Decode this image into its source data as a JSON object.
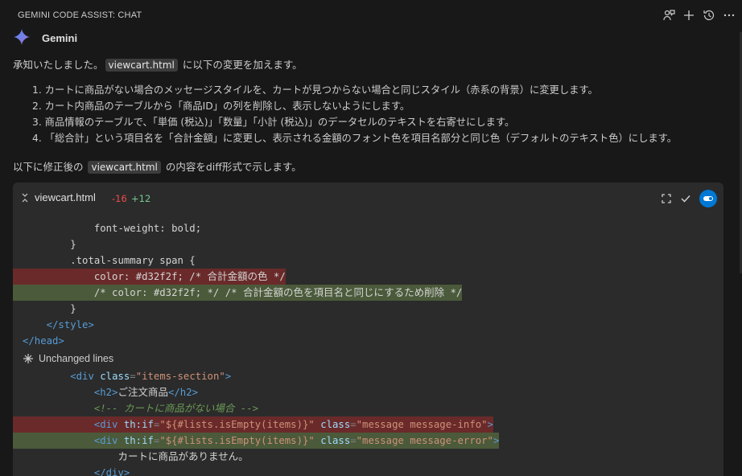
{
  "header": {
    "title": "GEMINI CODE ASSIST: CHAT",
    "icons": [
      "feedback-icon",
      "add-icon",
      "history-icon",
      "more-icon"
    ]
  },
  "assistant": {
    "name": "Gemini"
  },
  "intro": {
    "before": "承知いたしました。",
    "file": "viewcart.html",
    "after": " に以下の変更を加えます。"
  },
  "steps": [
    "1. カートに商品がない場合のメッセージスタイルを、カートが見つからない場合と同じスタイル（赤系の背景）に変更します。",
    "2. カート内商品のテーブルから「商品ID」の列を削除し、表示しないようにします。",
    "3. 商品情報のテーブルで、「単価 (税込)」「数量」「小計 (税込)」のデータセルのテキストを右寄せにします。",
    "4. 「総合計」という項目名を「合計金額」に変更し、表示される金額のフォント色を項目名部分と同じ色（デフォルトのテキスト色）にします。"
  ],
  "diff_intro": {
    "before": "以下に修正後の ",
    "file": "viewcart.html",
    "after": " の内容をdiff形式で示します。"
  },
  "codeblock": {
    "filename": "viewcart.html",
    "deleted": "-16",
    "added": "+12",
    "unchanged_label": "Unchanged lines",
    "accent": "#0078d4",
    "lines": {
      "l1": "font-weight: bold;",
      "l2": "}",
      "l3": ".total-summary span {",
      "l4_a": "color: #d32f2f; /* ",
      "l4_b": "合計金額の色",
      "l4_c": " */",
      "l5_a": "/* color: #d32f2f; */ /* ",
      "l5_b": "合計金額の色を項目名と同じにするため削除",
      "l5_c": " */",
      "l6": "}",
      "l7": "</style>",
      "l8": "</head>",
      "u1_tag_open": "<div",
      "u1_attr": "class",
      "u1_val": "\"items-section\"",
      "u1_close": ">",
      "u2_open": "<h2>",
      "u2_text": "ご注文商品",
      "u2_close": "</h2>",
      "u3_a": "<!-- ",
      "u3_b": "カートに商品がない場合",
      "u3_c": " -->",
      "u4_attr": "th:if",
      "u4_val": "\"${#lists.isEmpty(items)}\"",
      "u4_attr2": "class",
      "u4_val2": "\"message message-info\"",
      "u5_val2": "\"message message-error\"",
      "u6_text": "カートに商品がありません。",
      "u7": "</div>"
    }
  }
}
